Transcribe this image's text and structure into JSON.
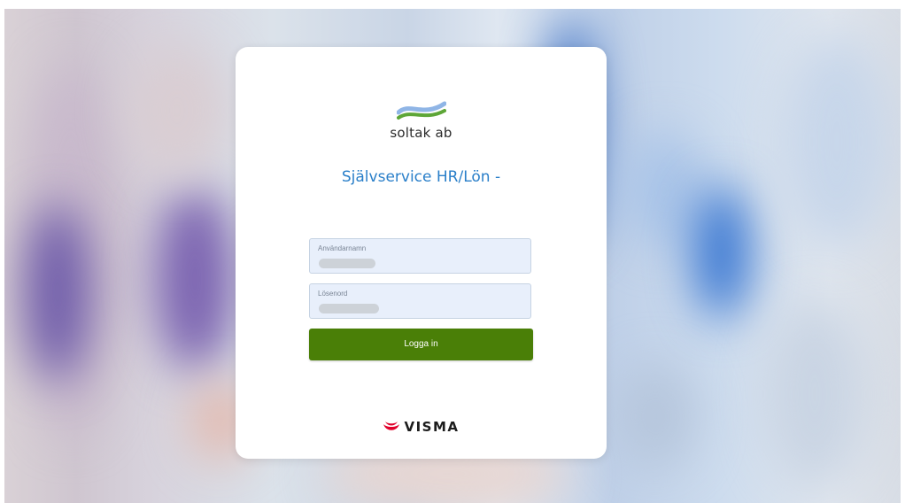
{
  "brand": {
    "company_name": "soltak ab",
    "vendor_name": "VISMA"
  },
  "login": {
    "title": "Självservice HR/Lön -",
    "username_label": "Användarnamn",
    "password_label": "Lösenord",
    "submit_label": "Logga in"
  },
  "colors": {
    "title_blue": "#2a7fc9",
    "button_green": "#4a7f07",
    "field_bg": "#e8effb",
    "visma_red": "#e0002a"
  }
}
